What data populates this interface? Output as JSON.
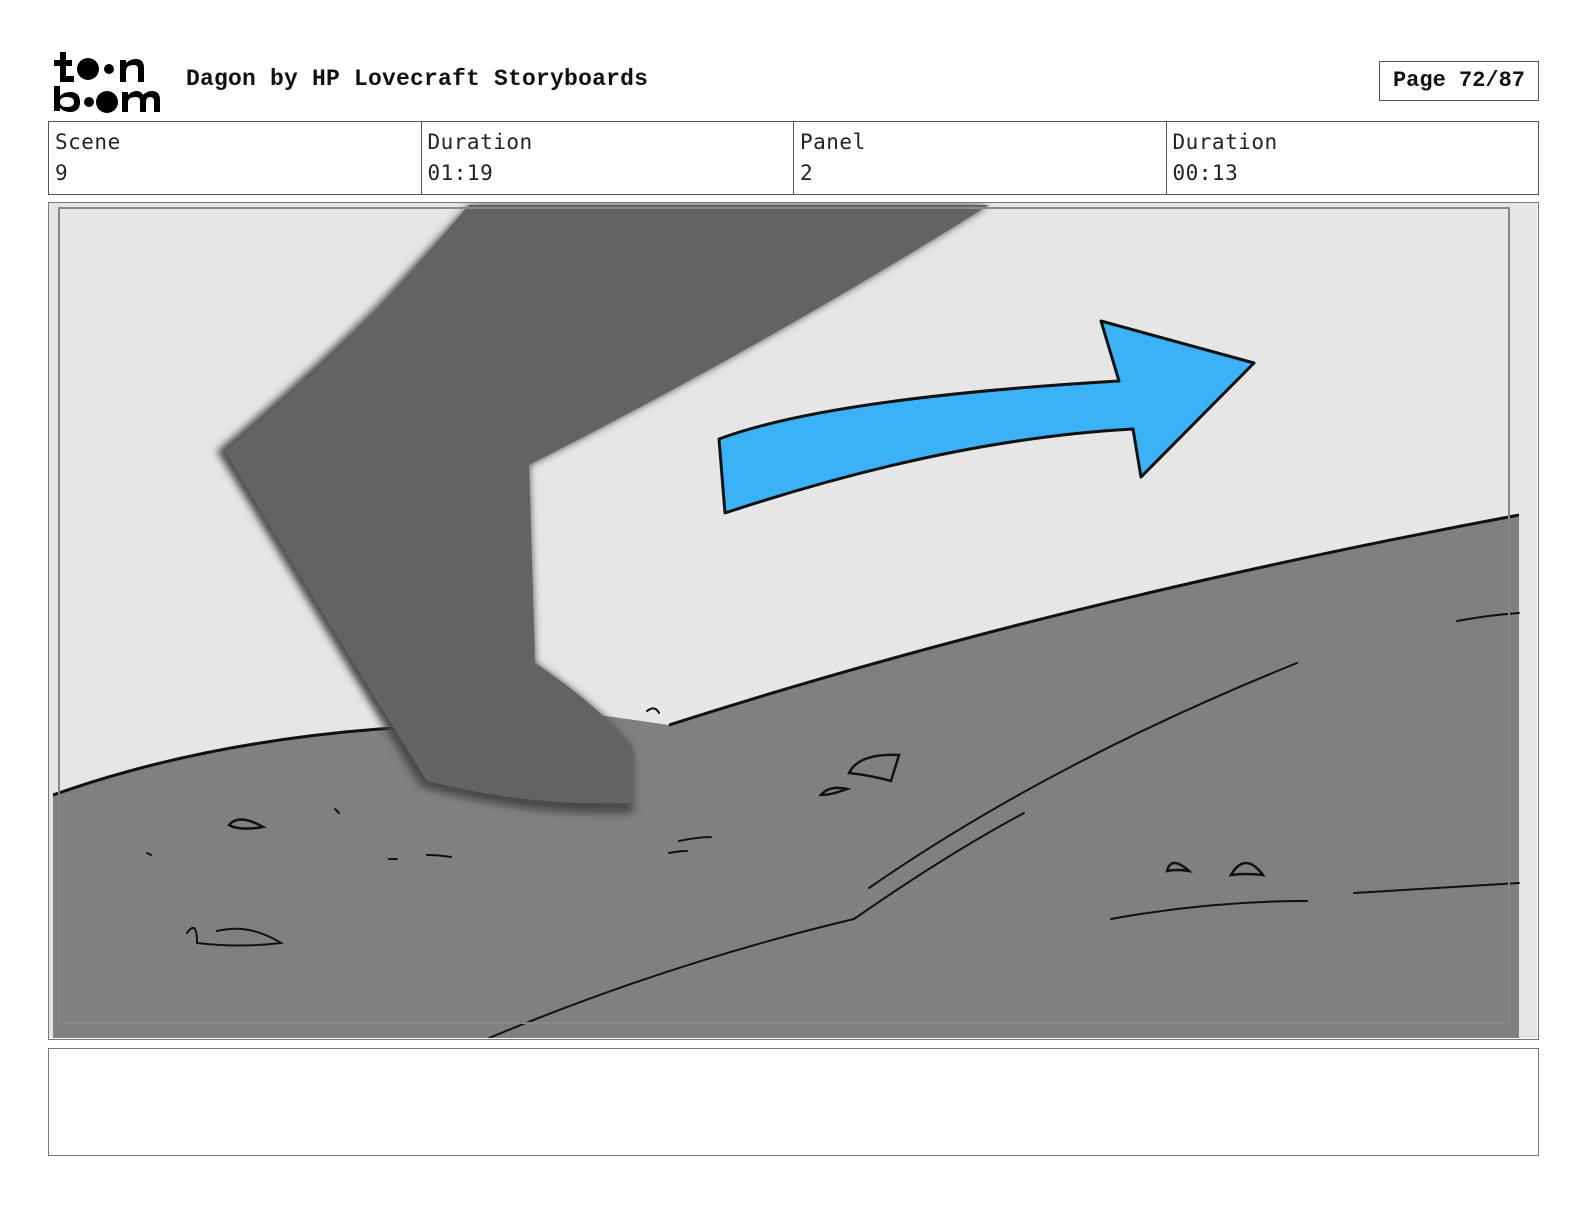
{
  "header": {
    "logo": {
      "line1": "toon",
      "line2": "boom"
    },
    "title": "Dagon by HP Lovecraft Storyboards",
    "page": "Page 72/87"
  },
  "info": {
    "scene_label": "Scene",
    "scene_value": "9",
    "duration_label": "Duration",
    "duration_value": "01:19",
    "panel_label": "Panel",
    "panel_value": "2",
    "panel_duration_label": "Duration",
    "panel_duration_value": "00:13"
  },
  "panel": {
    "arrow_color": "#3ab2f5",
    "sky_color": "#e6e6e6",
    "ground_color": "#808080",
    "leg_color": "#636363"
  },
  "notes": {
    "text": ""
  }
}
